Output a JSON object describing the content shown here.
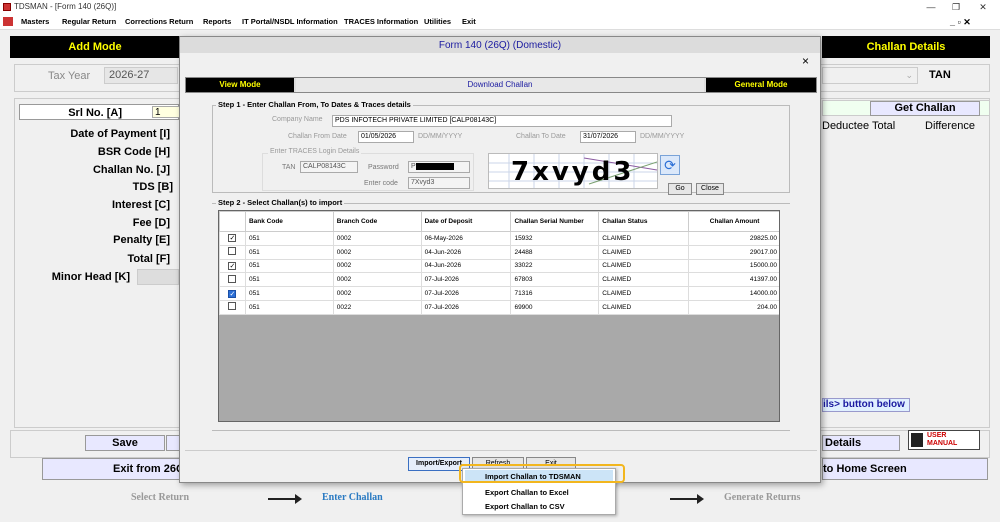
{
  "window": {
    "title": "TDSMAN - [Form 140 (26Q)]",
    "min": "—",
    "restore": "❐",
    "close": "✕",
    "inner_controls": "_ ▫ ✕"
  },
  "menu": [
    "Masters",
    "Regular Return",
    "Corrections Return",
    "Reports",
    "IT Portal/NSDL Information",
    "TRACES Information",
    "Utilities",
    "Exit"
  ],
  "main": {
    "add_mode": "Add Mode",
    "challan_details": "Challan Details",
    "tax_year_label": "Tax Year",
    "tax_year_value": "2026-27",
    "tan_label": "TAN",
    "srno_label": "Srl No. [A]",
    "srno_value": "1",
    "fields": [
      "Date of Payment [I]",
      "BSR Code [H]",
      "Challan No. [J]",
      "TDS [B]",
      "Interest [C]",
      "Fee [D]",
      "Penalty [E]",
      "Total [F]",
      "Minor Head [K]"
    ],
    "get_challan": "Get Challan",
    "deductee_total": "Deductee Total",
    "difference": "Difference",
    "hint_button": "ils> button below",
    "save": "Save",
    "details": "Details",
    "user_manual": "USER MANUAL",
    "exit_from": "Exit from 26Q",
    "home_screen": "to Home Screen",
    "steps": [
      "Select Return",
      "Enter Challan",
      "Generate Returns"
    ]
  },
  "dialog": {
    "title": "Form 140 (26Q) (Domestic)",
    "close": "×",
    "tabs": {
      "view_mode": "View Mode",
      "download": "Download Challan",
      "general_mode": "General Mode"
    },
    "step1": {
      "title": "Step 1 - Enter Challan From, To Dates & Traces details",
      "company_label": "Company Name",
      "company_value": "PDS INFOTECH PRIVATE LIMITED [CALP08143C]",
      "from_label": "Challan From Date",
      "from_value": "01/05/2026",
      "from_fmt": "DD/MM/YYYY",
      "to_label": "Challan To Date",
      "to_value": "31/07/2026",
      "to_fmt": "DD/MM/YYYY",
      "login_title": "Enter TRACES Login Details",
      "tan_label": "TAN",
      "tan_value": "CALP08143C",
      "password_label": "Password",
      "password_value": "P",
      "code_label": "Enter code",
      "code_value": "7Xvyd3",
      "captcha": "7xvyd3",
      "go": "Go",
      "close_btn": "Close"
    },
    "step2": {
      "title": "Step 2 - Select Challan(s) to import",
      "columns": [
        "Bank Code",
        "Branch Code",
        "Date of Deposit",
        "Challan Serial Number",
        "Challan Status",
        "Challan Amount"
      ],
      "rows": [
        {
          "checked": "✓",
          "state": "on",
          "bank": "051",
          "branch": "0002",
          "date": "06-May-2026",
          "serial": "15932",
          "status": "CLAIMED",
          "amount": "29825.00"
        },
        {
          "checked": "",
          "state": "off",
          "bank": "051",
          "branch": "0002",
          "date": "04-Jun-2026",
          "serial": "24488",
          "status": "CLAIMED",
          "amount": "29017.00"
        },
        {
          "checked": "✓",
          "state": "on",
          "bank": "051",
          "branch": "0002",
          "date": "04-Jun-2026",
          "serial": "33022",
          "status": "CLAIMED",
          "amount": "15000.00"
        },
        {
          "checked": "",
          "state": "off",
          "bank": "051",
          "branch": "0002",
          "date": "07-Jul-2026",
          "serial": "67803",
          "status": "CLAIMED",
          "amount": "41397.00"
        },
        {
          "checked": "✓",
          "state": "sel",
          "bank": "051",
          "branch": "0002",
          "date": "07-Jul-2026",
          "serial": "71316",
          "status": "CLAIMED",
          "amount": "14000.00"
        },
        {
          "checked": "",
          "state": "off",
          "bank": "051",
          "branch": "0022",
          "date": "07-Jul-2026",
          "serial": "69900",
          "status": "CLAIMED",
          "amount": "204.00"
        }
      ]
    },
    "import_export": "Import/Export",
    "refresh": "Refresh",
    "exit": "Exit"
  },
  "popup": {
    "items": [
      "Import Challan to TDSMAN",
      "Export Challan to Excel",
      "Export Challan to CSV"
    ],
    "highlight_color": "#f2b61e"
  }
}
